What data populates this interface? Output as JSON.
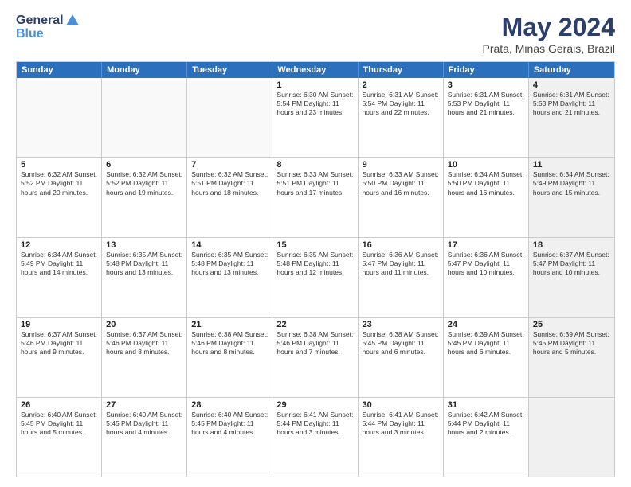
{
  "header": {
    "logo_line1": "General",
    "logo_line2": "Blue",
    "month": "May 2024",
    "location": "Prata, Minas Gerais, Brazil"
  },
  "day_headers": [
    "Sunday",
    "Monday",
    "Tuesday",
    "Wednesday",
    "Thursday",
    "Friday",
    "Saturday"
  ],
  "weeks": [
    [
      {
        "day": "",
        "empty": true
      },
      {
        "day": "",
        "empty": true
      },
      {
        "day": "",
        "empty": true
      },
      {
        "day": "1",
        "info": "Sunrise: 6:30 AM\nSunset: 5:54 PM\nDaylight: 11 hours\nand 23 minutes."
      },
      {
        "day": "2",
        "info": "Sunrise: 6:31 AM\nSunset: 5:54 PM\nDaylight: 11 hours\nand 22 minutes."
      },
      {
        "day": "3",
        "info": "Sunrise: 6:31 AM\nSunset: 5:53 PM\nDaylight: 11 hours\nand 21 minutes."
      },
      {
        "day": "4",
        "info": "Sunrise: 6:31 AM\nSunset: 5:53 PM\nDaylight: 11 hours\nand 21 minutes.",
        "shaded": true
      }
    ],
    [
      {
        "day": "5",
        "info": "Sunrise: 6:32 AM\nSunset: 5:52 PM\nDaylight: 11 hours\nand 20 minutes."
      },
      {
        "day": "6",
        "info": "Sunrise: 6:32 AM\nSunset: 5:52 PM\nDaylight: 11 hours\nand 19 minutes."
      },
      {
        "day": "7",
        "info": "Sunrise: 6:32 AM\nSunset: 5:51 PM\nDaylight: 11 hours\nand 18 minutes."
      },
      {
        "day": "8",
        "info": "Sunrise: 6:33 AM\nSunset: 5:51 PM\nDaylight: 11 hours\nand 17 minutes."
      },
      {
        "day": "9",
        "info": "Sunrise: 6:33 AM\nSunset: 5:50 PM\nDaylight: 11 hours\nand 16 minutes."
      },
      {
        "day": "10",
        "info": "Sunrise: 6:34 AM\nSunset: 5:50 PM\nDaylight: 11 hours\nand 16 minutes."
      },
      {
        "day": "11",
        "info": "Sunrise: 6:34 AM\nSunset: 5:49 PM\nDaylight: 11 hours\nand 15 minutes.",
        "shaded": true
      }
    ],
    [
      {
        "day": "12",
        "info": "Sunrise: 6:34 AM\nSunset: 5:49 PM\nDaylight: 11 hours\nand 14 minutes."
      },
      {
        "day": "13",
        "info": "Sunrise: 6:35 AM\nSunset: 5:48 PM\nDaylight: 11 hours\nand 13 minutes."
      },
      {
        "day": "14",
        "info": "Sunrise: 6:35 AM\nSunset: 5:48 PM\nDaylight: 11 hours\nand 13 minutes."
      },
      {
        "day": "15",
        "info": "Sunrise: 6:35 AM\nSunset: 5:48 PM\nDaylight: 11 hours\nand 12 minutes."
      },
      {
        "day": "16",
        "info": "Sunrise: 6:36 AM\nSunset: 5:47 PM\nDaylight: 11 hours\nand 11 minutes."
      },
      {
        "day": "17",
        "info": "Sunrise: 6:36 AM\nSunset: 5:47 PM\nDaylight: 11 hours\nand 10 minutes."
      },
      {
        "day": "18",
        "info": "Sunrise: 6:37 AM\nSunset: 5:47 PM\nDaylight: 11 hours\nand 10 minutes.",
        "shaded": true
      }
    ],
    [
      {
        "day": "19",
        "info": "Sunrise: 6:37 AM\nSunset: 5:46 PM\nDaylight: 11 hours\nand 9 minutes."
      },
      {
        "day": "20",
        "info": "Sunrise: 6:37 AM\nSunset: 5:46 PM\nDaylight: 11 hours\nand 8 minutes."
      },
      {
        "day": "21",
        "info": "Sunrise: 6:38 AM\nSunset: 5:46 PM\nDaylight: 11 hours\nand 8 minutes."
      },
      {
        "day": "22",
        "info": "Sunrise: 6:38 AM\nSunset: 5:46 PM\nDaylight: 11 hours\nand 7 minutes."
      },
      {
        "day": "23",
        "info": "Sunrise: 6:38 AM\nSunset: 5:45 PM\nDaylight: 11 hours\nand 6 minutes."
      },
      {
        "day": "24",
        "info": "Sunrise: 6:39 AM\nSunset: 5:45 PM\nDaylight: 11 hours\nand 6 minutes."
      },
      {
        "day": "25",
        "info": "Sunrise: 6:39 AM\nSunset: 5:45 PM\nDaylight: 11 hours\nand 5 minutes.",
        "shaded": true
      }
    ],
    [
      {
        "day": "26",
        "info": "Sunrise: 6:40 AM\nSunset: 5:45 PM\nDaylight: 11 hours\nand 5 minutes."
      },
      {
        "day": "27",
        "info": "Sunrise: 6:40 AM\nSunset: 5:45 PM\nDaylight: 11 hours\nand 4 minutes."
      },
      {
        "day": "28",
        "info": "Sunrise: 6:40 AM\nSunset: 5:45 PM\nDaylight: 11 hours\nand 4 minutes."
      },
      {
        "day": "29",
        "info": "Sunrise: 6:41 AM\nSunset: 5:44 PM\nDaylight: 11 hours\nand 3 minutes."
      },
      {
        "day": "30",
        "info": "Sunrise: 6:41 AM\nSunset: 5:44 PM\nDaylight: 11 hours\nand 3 minutes."
      },
      {
        "day": "31",
        "info": "Sunrise: 6:42 AM\nSunset: 5:44 PM\nDaylight: 11 hours\nand 2 minutes."
      },
      {
        "day": "",
        "empty": true,
        "shaded": true
      }
    ]
  ]
}
